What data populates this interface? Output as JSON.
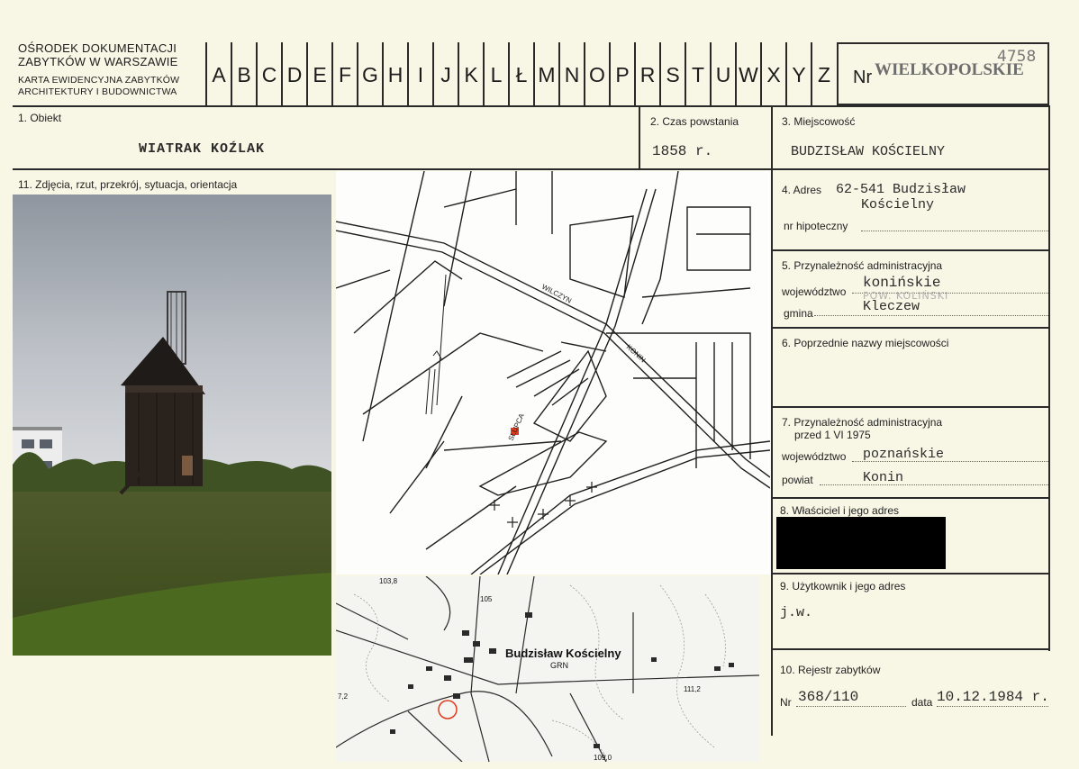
{
  "header": {
    "org_line1": "OŚRODEK DOKUMENTACJI",
    "org_line2": "ZABYTKÓW W WARSZAWIE",
    "card_line1": "KARTA EWIDENCYJNA ZABYTKÓW",
    "card_line2": "ARCHITEKTURY I BUDOWNICTWA",
    "letters": [
      "A",
      "B",
      "C",
      "D",
      "E",
      "F",
      "G",
      "H",
      "I",
      "J",
      "K",
      "L",
      "Ł",
      "M",
      "N",
      "O",
      "P",
      "R",
      "S",
      "T",
      "U",
      "W",
      "X",
      "Y",
      "Z"
    ],
    "nr_label": "Nr",
    "region_stamp": "WIELKOPOLSKIE",
    "nr_handwritten": "4758"
  },
  "fields": {
    "f1_label": "1. Obiekt",
    "f1_value": "WIATRAK KOŹLAK",
    "f2_label": "2. Czas powstania",
    "f2_value": "1858 r.",
    "f3_label": "3. Miejscowość",
    "f3_value": "BUDZISŁAW KOŚCIELNY",
    "f4_label": "4. Adres",
    "f4_value_line1": "62-541 Budzisław",
    "f4_value_line2": "Kościelny",
    "f4_hipoteczny_label": "nr hipoteczny",
    "f5_label": "5. Przynależność administracyjna",
    "f5_woj_label": "województwo",
    "f5_woj_value": "konińskie",
    "f5_pow_handwritten": "POW. KOLIŃSKI",
    "f5_gmina_label": "gmina",
    "f5_gmina_value": "Kleczew",
    "f6_label": "6. Poprzednie nazwy miejscowości",
    "f7_label_line1": "7. Przynależność administracyjna",
    "f7_label_line2": "przed 1 VI 1975",
    "f7_woj_label": "województwo",
    "f7_woj_value": "poznańskie",
    "f7_pow_label": "powiat",
    "f7_pow_value": "Konin",
    "f8_label": "8. Właściciel i jego adres",
    "f9_label": "9. Użytkownik i jego adres",
    "f9_value": "j.w.",
    "f10_label": "10. Rejestr zabytków",
    "f10_nr_label": "Nr",
    "f10_nr_value": "368/110",
    "f10_data_label": "data",
    "f10_data_value": "10.12.1984 r.",
    "f11_label": "11. Zdjęcia, rzut, przekrój, sytuacja, orientacja"
  },
  "site_map": {
    "street_wilczyn": "WILCZYN",
    "street_konin": "KONIN",
    "street_slupca": "SŁUPCA"
  },
  "topo_map": {
    "place_name": "Budzisław Kościelny",
    "grn": "GRN",
    "elev_1": "103,8",
    "elev_2": "105",
    "elev_3": "111,2",
    "elev_4": "109,0",
    "elev_5": "7,2"
  },
  "colors": {
    "paper": "#f8f6e5",
    "rule": "#2a2a2a",
    "marker_red": "#e03a1e"
  }
}
